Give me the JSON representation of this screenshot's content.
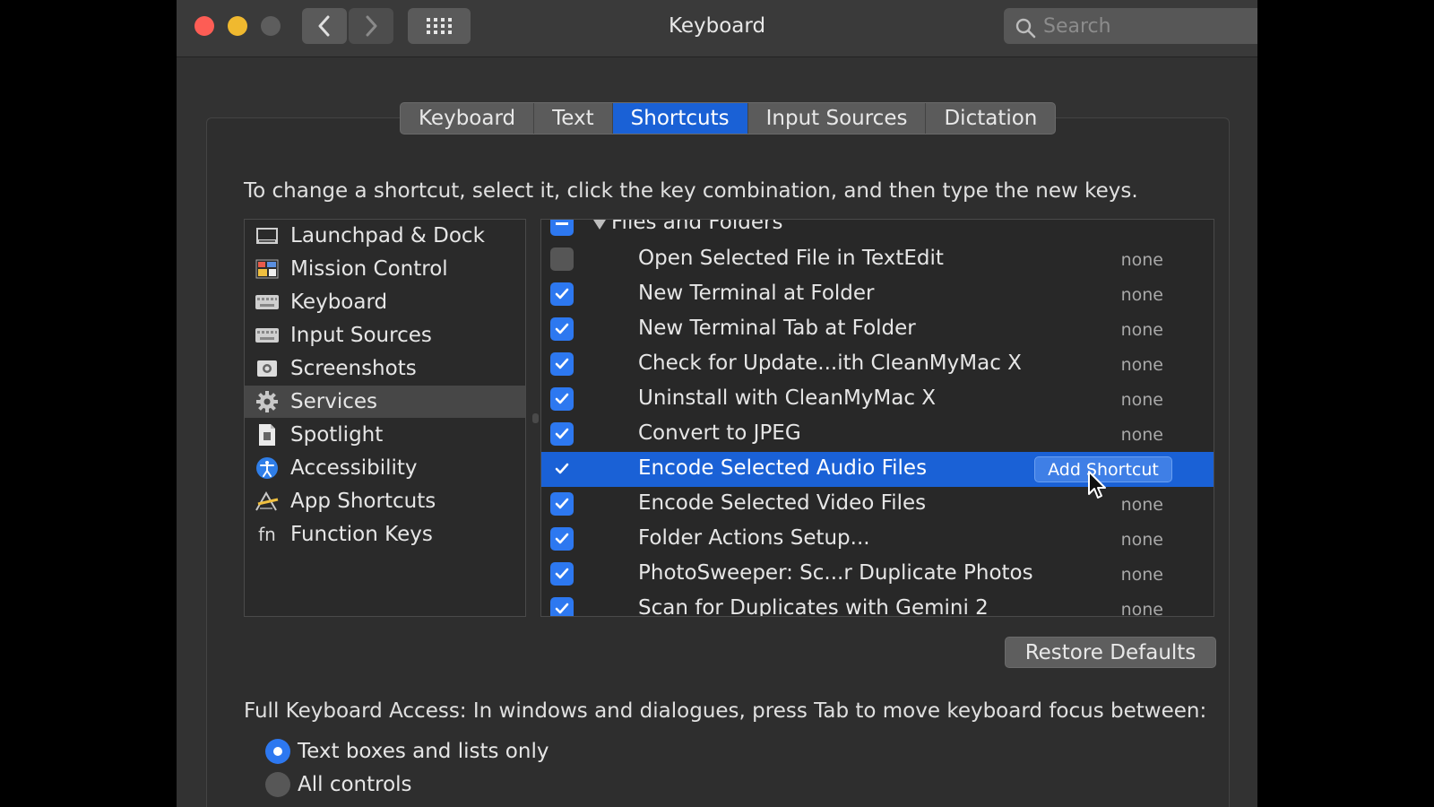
{
  "window": {
    "title": "Keyboard"
  },
  "search": {
    "placeholder": "Search"
  },
  "tabs": [
    {
      "label": "Keyboard",
      "active": false
    },
    {
      "label": "Text",
      "active": false
    },
    {
      "label": "Shortcuts",
      "active": true
    },
    {
      "label": "Input Sources",
      "active": false
    },
    {
      "label": "Dictation",
      "active": false
    }
  ],
  "instruction": "To change a shortcut, select it, click the key combination, and then type the new keys.",
  "categories": [
    {
      "label": "Launchpad & Dock",
      "icon": "launchpad-dock-icon"
    },
    {
      "label": "Mission Control",
      "icon": "mission-control-icon"
    },
    {
      "label": "Keyboard",
      "icon": "keyboard-icon"
    },
    {
      "label": "Input Sources",
      "icon": "input-sources-icon"
    },
    {
      "label": "Screenshots",
      "icon": "screenshots-icon"
    },
    {
      "label": "Services",
      "icon": "gear-icon",
      "selected": true
    },
    {
      "label": "Spotlight",
      "icon": "spotlight-icon"
    },
    {
      "label": "Accessibility",
      "icon": "accessibility-icon"
    },
    {
      "label": "App Shortcuts",
      "icon": "app-shortcuts-icon"
    },
    {
      "label": "Function Keys",
      "icon": "fn-icon",
      "glyph": "fn"
    }
  ],
  "shortcuts": {
    "group": "Files and Folders",
    "items": [
      {
        "name": "Open Selected File in TextEdit",
        "key": "none",
        "checked": false
      },
      {
        "name": "New Terminal at Folder",
        "key": "none",
        "checked": true
      },
      {
        "name": "New Terminal Tab at Folder",
        "key": "none",
        "checked": true
      },
      {
        "name": "Check for Update...ith CleanMyMac X",
        "key": "none",
        "checked": true
      },
      {
        "name": "Uninstall with CleanMyMac X",
        "key": "none",
        "checked": true
      },
      {
        "name": "Convert to JPEG",
        "key": "none",
        "checked": true
      },
      {
        "name": "Encode Selected Audio Files",
        "key": "Add Shortcut",
        "checked": true,
        "selected": true
      },
      {
        "name": "Encode Selected Video Files",
        "key": "none",
        "checked": true
      },
      {
        "name": "Folder Actions Setup...",
        "key": "none",
        "checked": true
      },
      {
        "name": "PhotoSweeper: Sc...r Duplicate Photos",
        "key": "none",
        "checked": true
      },
      {
        "name": "Scan for Duplicates with Gemini 2",
        "key": "none",
        "checked": true
      }
    ]
  },
  "restore_label": "Restore Defaults",
  "full_keyboard_access": {
    "text": "Full Keyboard Access: In windows and dialogues, press Tab to move keyboard focus between:",
    "options": [
      {
        "label": "Text boxes and lists only",
        "selected": true
      },
      {
        "label": "All controls",
        "selected": false
      }
    ]
  },
  "colors": {
    "accent": "#1a61d6",
    "checkbox": "#2d78f0",
    "close": "#fd5d55",
    "minimize": "#f0b92f"
  }
}
